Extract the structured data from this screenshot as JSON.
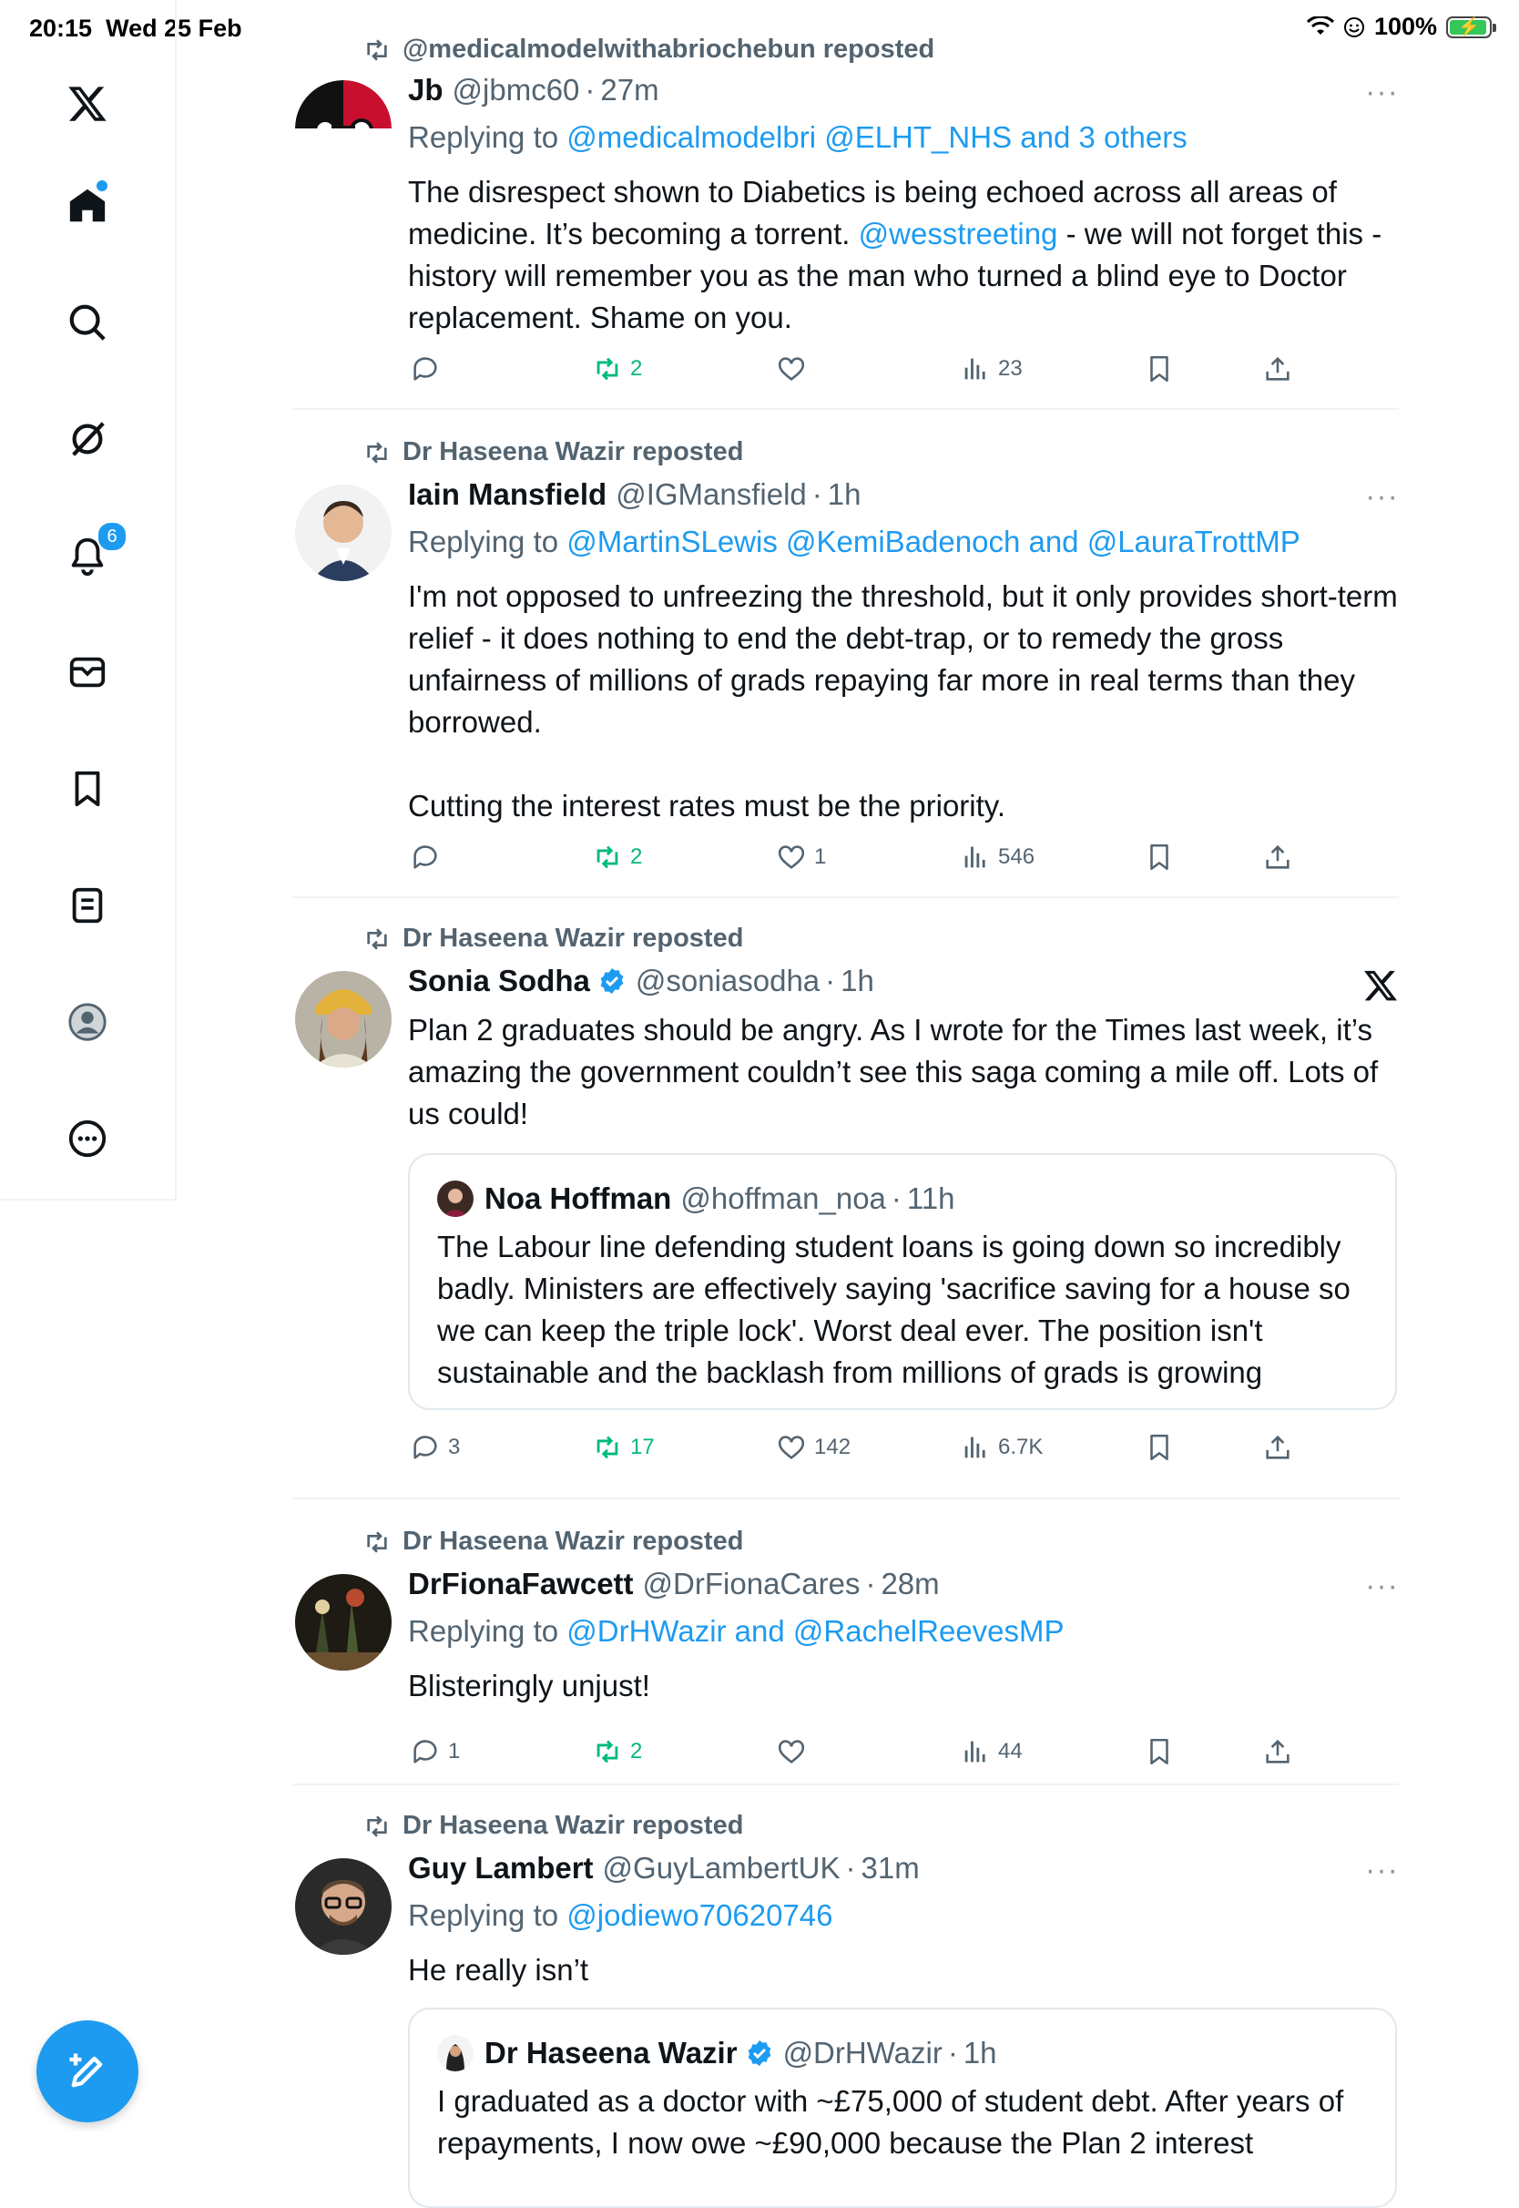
{
  "status": {
    "time": "20:15",
    "date": "Wed 25 Feb",
    "battery": "100%"
  },
  "sidebar": {
    "notifications_badge": "6",
    "items": [
      "x-logo",
      "home",
      "explore",
      "grok",
      "notifications",
      "messages",
      "bookmarks",
      "lists",
      "profile",
      "more"
    ]
  },
  "tweets": [
    {
      "repost_label": "@medicalmodelwithabriochebun reposted",
      "name": "Jb",
      "handle": "@jbmc60",
      "time": "27m",
      "replying_prefix": "Replying to ",
      "replying_to": "@medicalmodelbri @ELHT_NHS and 3 others",
      "body_a": "The disrespect shown to Diabetics is being echoed across all areas of medicine. It’s becoming a torrent. ",
      "body_mention": "@wesstreeting",
      "body_b": " - we will not forget this - history will remember you as the man who turned a blind eye to Doctor replacement. Shame on you.",
      "replies": "",
      "reposts": "2",
      "likes": "",
      "views": "23"
    },
    {
      "repost_label": "Dr Haseena Wazir reposted",
      "name": "Iain Mansfield",
      "handle": "@IGMansfield",
      "time": "1h",
      "replying_prefix": "Replying to ",
      "replying_to": "@MartinSLewis @KemiBadenoch and @LauraTrottMP",
      "body": "I'm not opposed to unfreezing the threshold, but it only provides short-term relief - it does nothing to end the debt-trap, or to remedy the gross unfairness of millions of grads repaying far more in real terms than they borrowed.\n\nCutting the interest rates must be the priority.",
      "replies": "",
      "reposts": "2",
      "likes": "1",
      "views": "546"
    },
    {
      "repost_label": "Dr Haseena Wazir reposted",
      "name": "Sonia Sodha",
      "handle": "@soniasodha",
      "time": "1h",
      "body": "Plan 2 graduates should be angry. As I wrote for the Times last week, it’s amazing the government couldn’t see this saga coming a mile off. Lots of us could!",
      "quote": {
        "name": "Noa Hoffman",
        "handle": "@hoffman_noa",
        "time": "11h",
        "body": "The Labour line defending student loans is going down so incredibly badly. Ministers are effectively saying 'sacrifice saving for a house so we can keep the triple lock'. Worst deal ever. The position isn't sustainable and the backlash from millions of grads is growing"
      },
      "replies": "3",
      "reposts": "17",
      "likes": "142",
      "views": "6.7K"
    },
    {
      "repost_label": "Dr Haseena Wazir reposted",
      "name": "DrFionaFawcett",
      "handle": "@DrFionaCares",
      "time": "28m",
      "replying_prefix": "Replying to ",
      "replying_to": "@DrHWazir and @RachelReevesMP",
      "body": "Blisteringly unjust!",
      "replies": "1",
      "reposts": "2",
      "likes": "",
      "views": "44"
    },
    {
      "repost_label": "Dr Haseena Wazir reposted",
      "name": "Guy Lambert",
      "handle": "@GuyLambertUK",
      "time": "31m",
      "replying_prefix": "Replying to ",
      "replying_to": "@jodiewo70620746",
      "body": "He really isn’t",
      "quote": {
        "name": "Dr Haseena Wazir",
        "handle": "@DrHWazir",
        "time": "1h",
        "body": "I graduated as a doctor with ~£75,000 of student debt. After years of repayments, I now owe ~£90,000 because the Plan 2 interest"
      }
    }
  ],
  "ui": {
    "sep": "·",
    "more": "···"
  },
  "colors": {
    "accent": "#1d9bf0",
    "repost_green": "#00ba7c",
    "muted": "#536471",
    "text": "#0f1419"
  }
}
